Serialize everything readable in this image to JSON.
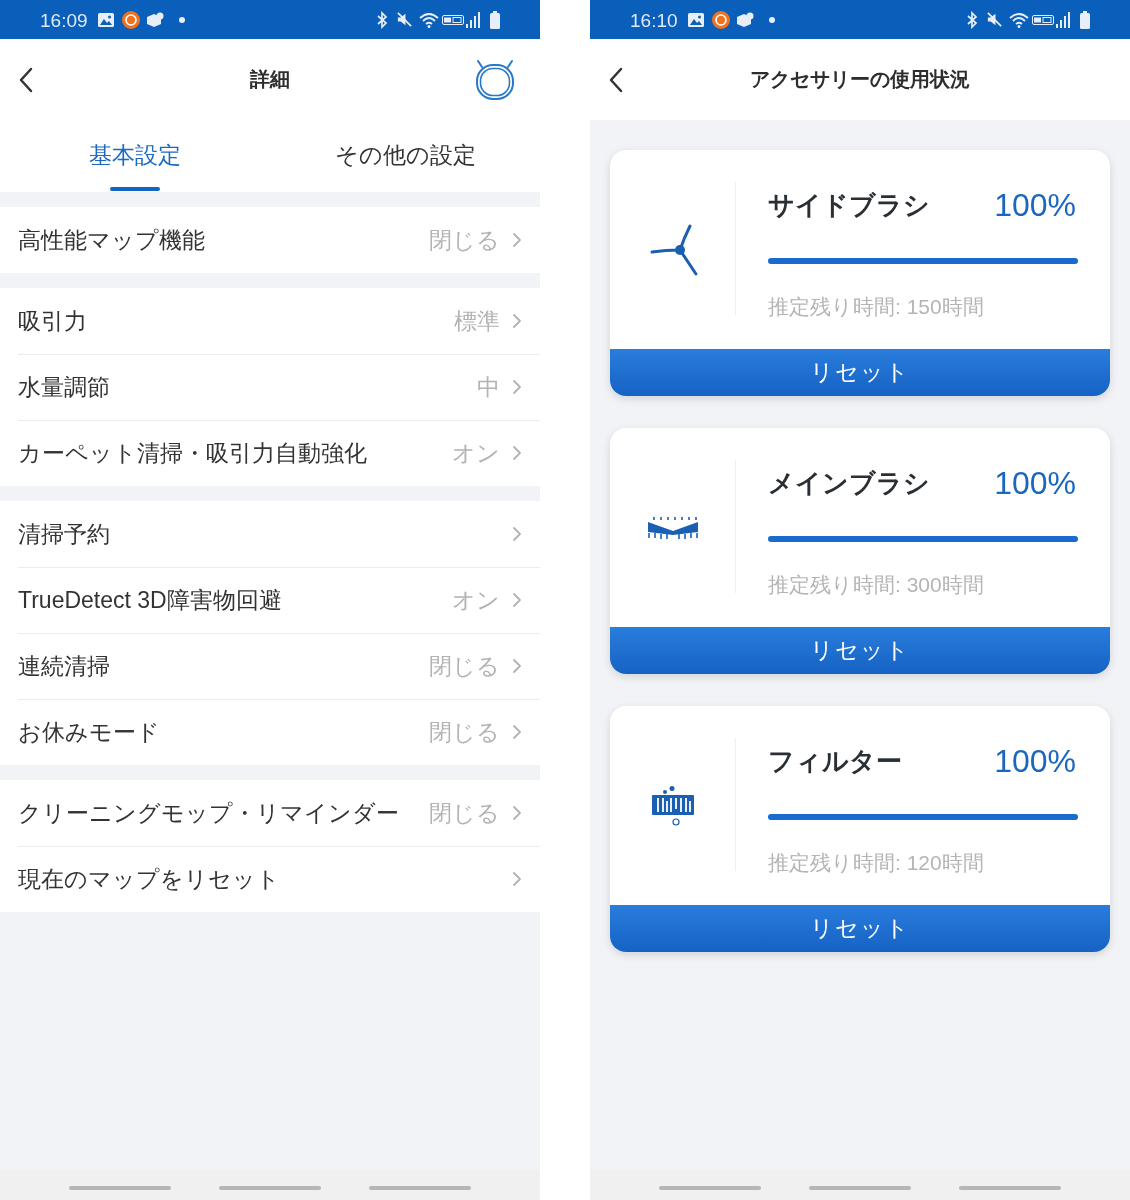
{
  "left_screen": {
    "status_bar": {
      "time": "16:09"
    },
    "header": {
      "title": "詳細"
    },
    "tabs": [
      {
        "label": "基本設定",
        "selected": true
      },
      {
        "label": "その他の設定",
        "selected": false
      }
    ],
    "groups": [
      {
        "rows": [
          {
            "label": "高性能マップ機能",
            "value": "閉じる"
          }
        ]
      },
      {
        "rows": [
          {
            "label": "吸引力",
            "value": "標準"
          },
          {
            "label": "水量調節",
            "value": "中"
          },
          {
            "label": "カーペット清掃・吸引力自動強化",
            "value": "オン"
          }
        ]
      },
      {
        "rows": [
          {
            "label": "清掃予約"
          },
          {
            "label": "TrueDetect 3D障害物回避",
            "value": "オン"
          },
          {
            "label": "連続清掃",
            "value": "閉じる"
          },
          {
            "label": "お休みモード",
            "value": "閉じる"
          }
        ]
      },
      {
        "rows": [
          {
            "label": "クリーニングモップ・リマインダー",
            "value": "閉じる"
          },
          {
            "label": "現在のマップをリセット"
          }
        ]
      }
    ]
  },
  "right_screen": {
    "status_bar": {
      "time": "16:10"
    },
    "header": {
      "title": "アクセサリーの使用状況"
    },
    "accessories": [
      {
        "kind": "side_brush",
        "name": "サイドブラシ",
        "percent": "100%",
        "level": 1,
        "remaining": "推定残り時間: 150時間",
        "button": "リセット"
      },
      {
        "kind": "main_brush",
        "name": "メインブラシ",
        "percent": "100%",
        "level": 1,
        "remaining": "推定残り時間: 300時間",
        "button": "リセット"
      },
      {
        "kind": "filter",
        "name": "フィルター",
        "percent": "100%",
        "level": 1,
        "remaining": "推定残り時間: 120時間",
        "button": "リセット"
      }
    ]
  }
}
